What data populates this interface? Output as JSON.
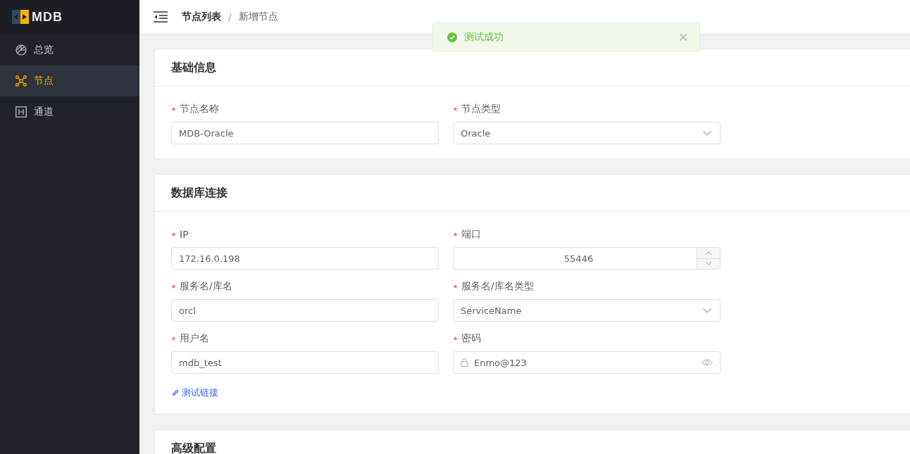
{
  "sidebar": {
    "logo": "MDB",
    "items": [
      {
        "label": "总览",
        "selected": false
      },
      {
        "label": "节点",
        "selected": true
      },
      {
        "label": "通道",
        "selected": false
      }
    ]
  },
  "breadcrumb": {
    "separator": "/",
    "items": [
      "节点列表",
      "新增节点"
    ]
  },
  "toast": {
    "kind": "success",
    "message": "测试成功"
  },
  "sections": [
    {
      "title": "基础信息",
      "fields": [
        {
          "label": "节点名称",
          "required": true,
          "kind": "text",
          "value": "MDB-Oracle"
        },
        {
          "label": "节点类型",
          "required": true,
          "kind": "select",
          "value": "Oracle"
        }
      ]
    },
    {
      "title": "数据库连接",
      "fields": [
        {
          "label": "IP",
          "required": true,
          "kind": "text",
          "value": "172.16.0.198"
        },
        {
          "label": "端口",
          "required": true,
          "kind": "number",
          "value": "55446"
        },
        {
          "label": "服务名/库名",
          "required": true,
          "kind": "text",
          "value": "orcl"
        },
        {
          "label": "服务名/库名类型",
          "required": true,
          "kind": "select",
          "value": "ServiceName"
        },
        {
          "label": "用户名",
          "required": true,
          "kind": "text",
          "value": "mdb_test"
        },
        {
          "label": "密码",
          "required": true,
          "kind": "password",
          "value": "Enmo@123"
        }
      ],
      "link": "测试链接"
    },
    {
      "title": "高级配置"
    }
  ]
}
